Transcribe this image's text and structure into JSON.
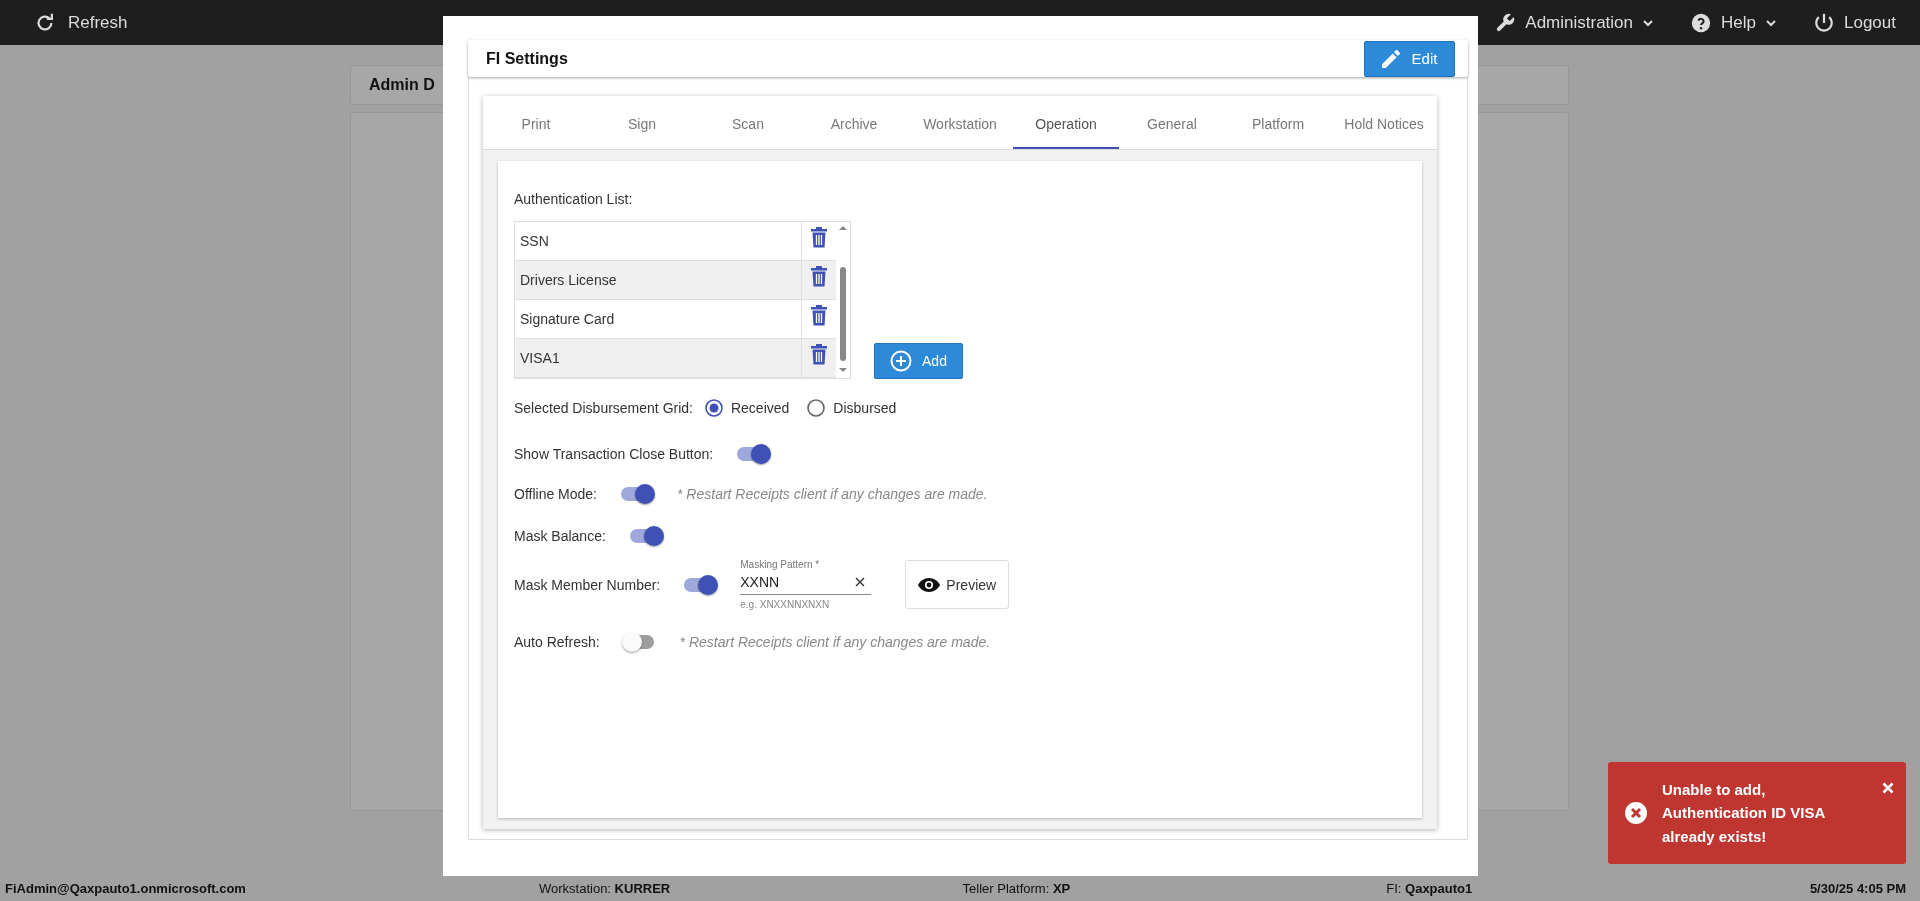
{
  "top_bar": {
    "refresh": "Refresh",
    "menus": [
      {
        "kind": "admin",
        "label": "Administration",
        "menu": true
      },
      {
        "kind": "help",
        "label": "Help",
        "menu": true
      },
      {
        "kind": "logout",
        "label": "Logout",
        "menu": false
      }
    ]
  },
  "background": {
    "card_title": "Admin D"
  },
  "dialog": {
    "title": "FI Settings",
    "edit_button": "Edit",
    "tabs": [
      {
        "label": "Print",
        "selected": false
      },
      {
        "label": "Sign",
        "selected": false
      },
      {
        "label": "Scan",
        "selected": false
      },
      {
        "label": "Archive",
        "selected": false
      },
      {
        "label": "Workstation",
        "selected": false
      },
      {
        "label": "Operation",
        "selected": true
      },
      {
        "label": "General",
        "selected": false
      },
      {
        "label": "Platform",
        "selected": false
      },
      {
        "label": "Hold Notices",
        "selected": false
      }
    ],
    "auth_list": {
      "label": "Authentication List:",
      "items": [
        {
          "name": "SSN"
        },
        {
          "name": "Drivers License"
        },
        {
          "name": "Signature Card"
        },
        {
          "name": "VISA1"
        }
      ],
      "add_button": "Add"
    },
    "disbursement": {
      "label": "Selected Disbursement Grid:",
      "options": [
        {
          "label": "Received",
          "selected": true
        },
        {
          "label": "Disbursed",
          "selected": false
        }
      ]
    },
    "settings": [
      {
        "kind": "toggle",
        "label": "Show Transaction Close Button:",
        "on": true
      },
      {
        "kind": "toggle",
        "label": "Offline Mode:",
        "on": true,
        "note": "* Restart Receipts client if any changes are made."
      },
      {
        "kind": "toggle",
        "label": "Mask Balance:",
        "on": true
      },
      {
        "kind": "mask",
        "label": "Mask Member Number:",
        "on": true,
        "field": {
          "label": "Masking Pattern *",
          "value": "XXNN",
          "hint": "e.g. XNXXNNXNXN"
        },
        "preview_button": "Preview"
      },
      {
        "kind": "toggle",
        "label": "Auto Refresh:",
        "on": false,
        "note": "* Restart Receipts client if any changes are made."
      }
    ]
  },
  "status_bar": {
    "user": "FiAdmin@Qaxpauto1.onmicrosoft.com",
    "fields": [
      {
        "label": "Workstation:",
        "value": "KURRER"
      },
      {
        "label": "Teller Platform:",
        "value": "XP"
      },
      {
        "label": "FI:",
        "value": "Qaxpauto1"
      }
    ],
    "datetime": "5/30/25 4:05 PM"
  },
  "toast": {
    "message": "Unable to add, Authentication ID VISA already exists!"
  }
}
